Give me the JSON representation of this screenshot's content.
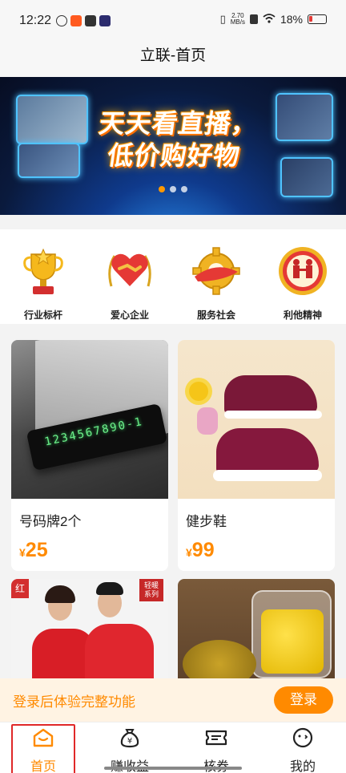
{
  "status_bar": {
    "time": "12:22",
    "network_speed_value": "2.70",
    "network_speed_unit": "MB/s",
    "battery": "18%"
  },
  "header": {
    "title": "立联-首页"
  },
  "banner": {
    "slogan_line1": "天天看直播，",
    "slogan_line2": "低价购好物",
    "page_indicator_active": 1,
    "page_indicator_count": 3
  },
  "honors": [
    {
      "label": "行业标杆",
      "icon": "trophy-icon"
    },
    {
      "label": "爱心企业",
      "icon": "heart-handshake-icon"
    },
    {
      "label": "服务社会",
      "icon": "gear-ribbon-icon"
    },
    {
      "label": "利他精神",
      "icon": "handshake-badge-icon"
    }
  ],
  "products": [
    {
      "name": "号码牌2个",
      "currency": "¥",
      "price": "25",
      "image": "parking-number-plate"
    },
    {
      "name": "健步鞋",
      "currency": "¥",
      "price": "99",
      "image": "walking-shoes"
    },
    {
      "name": "",
      "currency": "",
      "price": "",
      "image": "red-thermal-clothing",
      "corner_tag": "红",
      "brand_tag_line1": "轻暖",
      "brand_tag_line2": "系列"
    },
    {
      "name": "",
      "currency": "",
      "price": "",
      "image": "chrysanthemum-tea"
    }
  ],
  "login_bar": {
    "tip": "登录后体验完整功能",
    "button": "登录"
  },
  "tab_bar": [
    {
      "label": "首页",
      "icon": "home-icon",
      "active": true
    },
    {
      "label": "赚收益",
      "icon": "money-bag-icon",
      "active": false
    },
    {
      "label": "核券",
      "icon": "ticket-icon",
      "active": false
    },
    {
      "label": "我的",
      "icon": "user-face-icon",
      "active": false
    }
  ],
  "colors": {
    "accent": "#ff8a00",
    "highlight_border": "#e02828"
  }
}
